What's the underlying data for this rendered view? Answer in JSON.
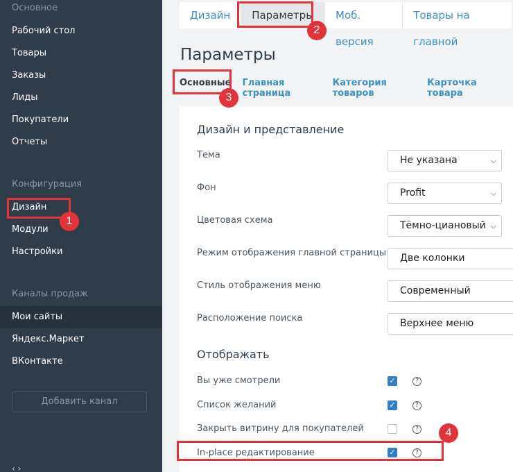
{
  "sidebar": {
    "section_main": "Основное",
    "main_items": [
      "Рабочий стол",
      "Товары",
      "Заказы",
      "Лиды",
      "Покупатели",
      "Отчеты"
    ],
    "section_config": "Конфигурация",
    "config_items": [
      "Дизайн",
      "Модули",
      "Настройки"
    ],
    "section_channels": "Каналы продаж",
    "channel_items": [
      "Мои сайты",
      "Яндекс.Маркет",
      "ВКонтакте"
    ],
    "add_channel": "Добавить канал"
  },
  "tabs": [
    "Дизайн",
    "Параметры",
    "Моб. версия",
    "Товары на главной"
  ],
  "page_title": "Параметры",
  "subtabs": [
    "Основные",
    "Главная страница",
    "Категория товаров",
    "Карточка товара"
  ],
  "design_section": {
    "title": "Дизайн и представление",
    "fields": [
      {
        "label": "Тема",
        "value": "Не указана"
      },
      {
        "label": "Фон",
        "value": "Profit"
      },
      {
        "label": "Цветовая схема",
        "value": "Тёмно-циановый"
      },
      {
        "label": "Режим отображения главной страницы",
        "value": "Две колонки"
      },
      {
        "label": "Стиль отображения меню",
        "value": "Современный"
      },
      {
        "label": "Расположение поиска",
        "value": "Верхнее меню"
      }
    ]
  },
  "display_section": {
    "title": "Отображать",
    "options": [
      {
        "label": "Вы уже смотрели",
        "checked": true
      },
      {
        "label": "Список желаний",
        "checked": true
      },
      {
        "label": "Закрыть витрину для покупателей",
        "checked": false
      },
      {
        "label": "In-place редактирование",
        "checked": true
      }
    ]
  },
  "annotations": [
    "1",
    "2",
    "3",
    "4"
  ],
  "colors": {
    "highlight": "#e0343a",
    "link": "#3a92c8",
    "sidebar": "#2f3c4a"
  }
}
